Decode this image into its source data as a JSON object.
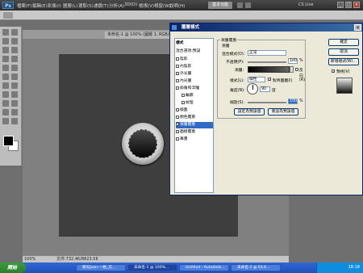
{
  "app": {
    "logo": "Ps",
    "menus": [
      "檔案(F)",
      "編輯(E)",
      "影像(I)",
      "圖層(L)",
      "選取(S)",
      "濾鏡(T)",
      "分析(A)",
      "3D(D)",
      "檢視(V)",
      "視窗(W)",
      "說明(H)"
    ],
    "zoom": "100%",
    "workspace_label": "基本功能",
    "cs_live": "CS Live"
  },
  "document": {
    "tabs": [
      "未命名-1 @ 100% (圖層 1, RGB/8)"
    ],
    "zoom": "100%",
    "status_text": "文件:732.4K/8823.5K"
  },
  "dialog": {
    "title": "圖層樣式",
    "styles_header": "樣式",
    "blend_options": "混合選項:預設",
    "style_items": [
      {
        "label": "陰影",
        "checked": false,
        "selected": false
      },
      {
        "label": "內陰影",
        "checked": false,
        "selected": false
      },
      {
        "label": "外光暈",
        "checked": false,
        "selected": false
      },
      {
        "label": "內光暈",
        "checked": false,
        "selected": false
      },
      {
        "label": "斜角和浮雕",
        "checked": false,
        "selected": false
      },
      {
        "label": "輪廓",
        "checked": false,
        "selected": false
      },
      {
        "label": "紋理",
        "checked": false,
        "selected": false
      },
      {
        "label": "緞面",
        "checked": false,
        "selected": false
      },
      {
        "label": "顏色覆蓋",
        "checked": false,
        "selected": false
      },
      {
        "label": "漸層覆蓋",
        "checked": true,
        "selected": true
      },
      {
        "label": "圖樣覆蓋",
        "checked": false,
        "selected": false
      },
      {
        "label": "筆畫",
        "checked": false,
        "selected": false
      }
    ],
    "panel": {
      "title": "漸層覆蓋",
      "subtitle": "漸層",
      "blend_mode_label": "混合模式(O):",
      "blend_mode_value": "正常",
      "opacity_label": "不透明(P):",
      "opacity_value": "100",
      "opacity_unit": "%",
      "gradient_label": "漸層:",
      "reverse_label": "反向(R)",
      "style_label": "樣式(L):",
      "style_value": "線性",
      "align_label": "對齊圖層(I)",
      "angle_label": "角度(N):",
      "angle_value": "90",
      "angle_unit": "度",
      "scale_label": "縮放(S):",
      "scale_value": "100",
      "scale_unit": "%",
      "make_default": "設定為預設值",
      "reset_default": "重設為預設值"
    },
    "buttons": {
      "ok": "確定",
      "cancel": "取消",
      "new_style": "新增樣式(W)...",
      "preview": "預視(V)"
    }
  },
  "taskbar": {
    "start": "開始",
    "tasks": [
      "聊天Joan-一枚_交...",
      "未命名-1 @ 100%...",
      "Untitled - Autodesk...",
      "未命名-2 @ 63.6..."
    ],
    "clock": "18:18"
  }
}
